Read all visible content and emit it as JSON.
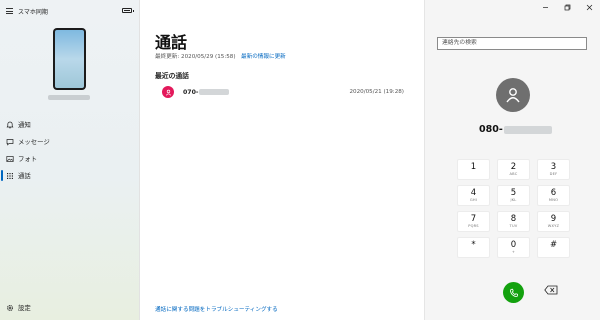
{
  "app": {
    "title": "スマホ同期"
  },
  "sidebar": {
    "battery_level": 0.7,
    "items": [
      {
        "label": "通知",
        "icon": "bell-icon"
      },
      {
        "label": "メッセージ",
        "icon": "chat-icon"
      },
      {
        "label": "フォト",
        "icon": "photo-icon"
      },
      {
        "label": "通話",
        "icon": "dialpad-icon",
        "active": true
      }
    ],
    "settings_label": "設定"
  },
  "calls": {
    "title": "通話",
    "last_updated": "最終更新: 2020/05/29 (15:58)",
    "refresh_label": "最新の情報に更新",
    "recent_title": "最近の通話",
    "recent": [
      {
        "number_prefix": "070-",
        "date": "2020/05/21 (19:28)",
        "avatar_color": "#e3195b"
      }
    ],
    "troubleshoot_link": "通話に関する問題をトラブルシューティングする"
  },
  "dialer": {
    "search_placeholder": "連絡先の検索",
    "number_prefix": "080-",
    "keys": [
      {
        "digit": "1",
        "letters": ""
      },
      {
        "digit": "2",
        "letters": "ABC"
      },
      {
        "digit": "3",
        "letters": "DEF"
      },
      {
        "digit": "4",
        "letters": "GHI"
      },
      {
        "digit": "5",
        "letters": "JKL"
      },
      {
        "digit": "6",
        "letters": "MNO"
      },
      {
        "digit": "7",
        "letters": "PQRS"
      },
      {
        "digit": "8",
        "letters": "TUV"
      },
      {
        "digit": "9",
        "letters": "WXYZ"
      },
      {
        "digit": "*",
        "letters": ""
      },
      {
        "digit": "0",
        "letters": "+"
      },
      {
        "digit": "#",
        "letters": ""
      }
    ],
    "call_color": "#13a10e"
  },
  "colors": {
    "accent": "#0067c0"
  }
}
